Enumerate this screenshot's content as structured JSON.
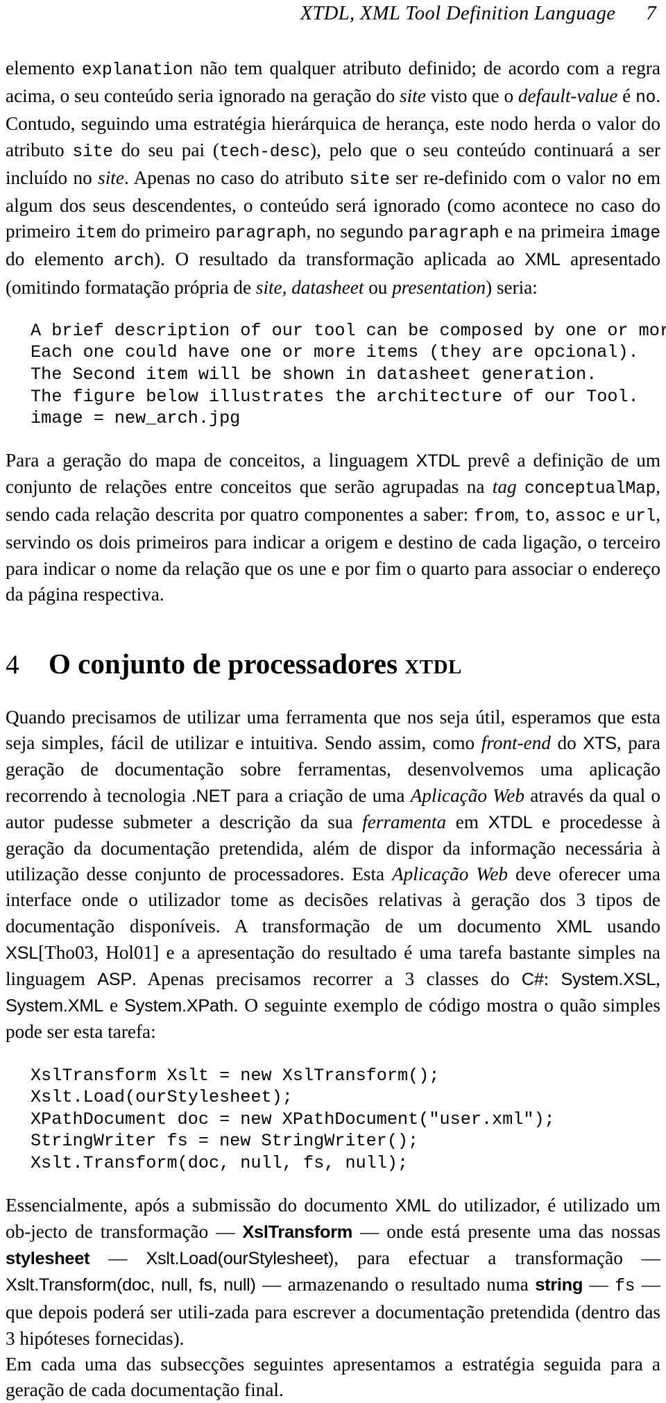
{
  "header": {
    "title": "XTDL, XML Tool Definition Language",
    "page_number": "7"
  },
  "paragraphs": {
    "p1": {
      "s1": "elemento ",
      "code1": "explanation",
      "s2": " não tem qualquer atributo definido; de acordo com a regra acima, o seu conteúdo seria ignorado na geração do ",
      "it1": "site",
      "s3": " visto que o ",
      "it2": "default-value",
      "s4": " é ",
      "code2": "no",
      "s5": ". Contudo, seguindo uma estratégia hierárquica de herança, este nodo herda o valor do atributo ",
      "code3": "site",
      "s6": " do seu pai (",
      "code4": "tech-desc",
      "s7": "), pelo que o seu conteúdo continuará a ser incluído no ",
      "it3": "site",
      "s8": ". Apenas no caso do atributo ",
      "code5": "site",
      "s9": " ser re-definido com o valor ",
      "code6": "no",
      "s10": " em algum dos seus descendentes, o conteúdo será ignorado (como acontece no caso do primeiro ",
      "code7": "item",
      "s11": " do primeiro ",
      "code8": "paragraph",
      "s12": ", no segundo ",
      "code9": "paragraph",
      "s13": " e na primeira ",
      "code10": "image",
      "s14": " do elemento ",
      "code11": "arch",
      "s15": "). O resultado da transformação aplicada ao ",
      "sf1": "XML",
      "s16": " apresentado (omitindo formatação própria de ",
      "it4": "site, datasheet",
      "s17": " ou ",
      "it5": "presentation",
      "s18": ") seria:"
    },
    "p2": {
      "s1": "Para a geração do mapa de conceitos, a linguagem ",
      "sf1": "XTDL",
      "s2": " prevê a definição de um conjunto de relações entre conceitos que serão agrupadas na ",
      "it1": "tag",
      "s3": " ",
      "code1": "conceptualMap",
      "s4": ", sendo cada relação descrita por quatro componentes a saber: ",
      "code2": "from",
      "s5": ", ",
      "code3": "to",
      "s6": ", ",
      "code4": "assoc",
      "s7": " e ",
      "code5": "url",
      "s8": ", servindo os dois primeiros para indicar a origem e destino de cada ligação, o terceiro para indicar o nome da relação que os une e por fim o quarto para associar o endereço da página respectiva."
    },
    "p3": {
      "s1": "Quando precisamos de utilizar uma ferramenta que nos seja útil, esperamos que esta seja simples, fácil de utilizar e intuitiva. Sendo assim, como ",
      "it1": "front-end",
      "s2": " do ",
      "sf1": "XTS",
      "s3": ", para geração de documentação sobre ferramentas, desenvolvemos uma aplicação recorrendo à tecnologia ",
      "sf2": ".NET",
      "s4": " para a criação de uma ",
      "it2": "Aplicação Web",
      "s5": " através da qual o autor pudesse submeter a descrição da sua ",
      "it3": "ferramenta",
      "s6": " em ",
      "sf3": "XTDL",
      "s7": " e procedesse à geração da documentação pretendida, além de dispor da informação necessária à utilização desse conjunto de processadores. Esta ",
      "it4": "Aplicação Web",
      "s8": " deve oferecer uma interface onde o utilizador tome as decisões relativas à geração dos 3 tipos de documentação disponíveis. A transformação de um documento ",
      "sf4": "XML",
      "s9": " usando ",
      "sf5": "XSL",
      "s10": "[Tho03, Hol01] e a apresentação do resultado é uma tarefa bastante simples na linguagem ",
      "sf6": "ASP",
      "s11": ". Apenas precisamos recorrer a 3 classes do ",
      "sf7": "C#",
      "s12": ": ",
      "sf8": "System.XSL",
      "s13": ", ",
      "sf9": "System.XML",
      "s14": " e ",
      "sf10": "System.XPath",
      "s15": ". O seguinte exemplo de código mostra o quão simples pode ser esta tarefa:"
    },
    "p4": {
      "s1": "Essencialmente, após a submissão do documento ",
      "sf1": "XML",
      "s2": " do utilizador, é utilizado um ob-jecto de transformação — ",
      "sfb1": "XslTransform",
      "s3": " — onde está presente uma das nossas ",
      "sfb2": "stylesheet",
      "s4": " — ",
      "sf2": "Xslt.Load(ourStylesheet)",
      "s5": ", para efectuar a transformação — ",
      "sf3": "Xslt.Transform(doc, null, fs, null)",
      "s6": " — armazenando o resultado numa ",
      "sfb3": "string",
      "s7": " — ",
      "code1": "fs",
      "s8": " — que depois poderá ser utili-zada para escrever a documentação pretendida (dentro das 3 hipóteses fornecidas)."
    },
    "p5": {
      "s1": "Em cada uma das subsecções seguintes apresentamos a estratégia seguida para a geração de cada documentação final."
    }
  },
  "verbatim_output": [
    "A brief description of our tool can be composed by one or more paragraphs.",
    "Each one could have one or more items (they are opcional).",
    "The Second item will be shown in datasheet generation.",
    "The figure below illustrates the architecture of our Tool.",
    "image = new_arch.jpg"
  ],
  "section": {
    "number": "4",
    "title_main": "O conjunto de processadores ",
    "title_smallcaps": "xtdl"
  },
  "code_listing": [
    "XslTransform Xslt = new XslTransform();",
    "Xslt.Load(ourStylesheet);",
    "XPathDocument doc = new XPathDocument(\"user.xml\");",
    "StringWriter fs = new StringWriter();",
    "Xslt.Transform(doc, null, fs, null);"
  ]
}
